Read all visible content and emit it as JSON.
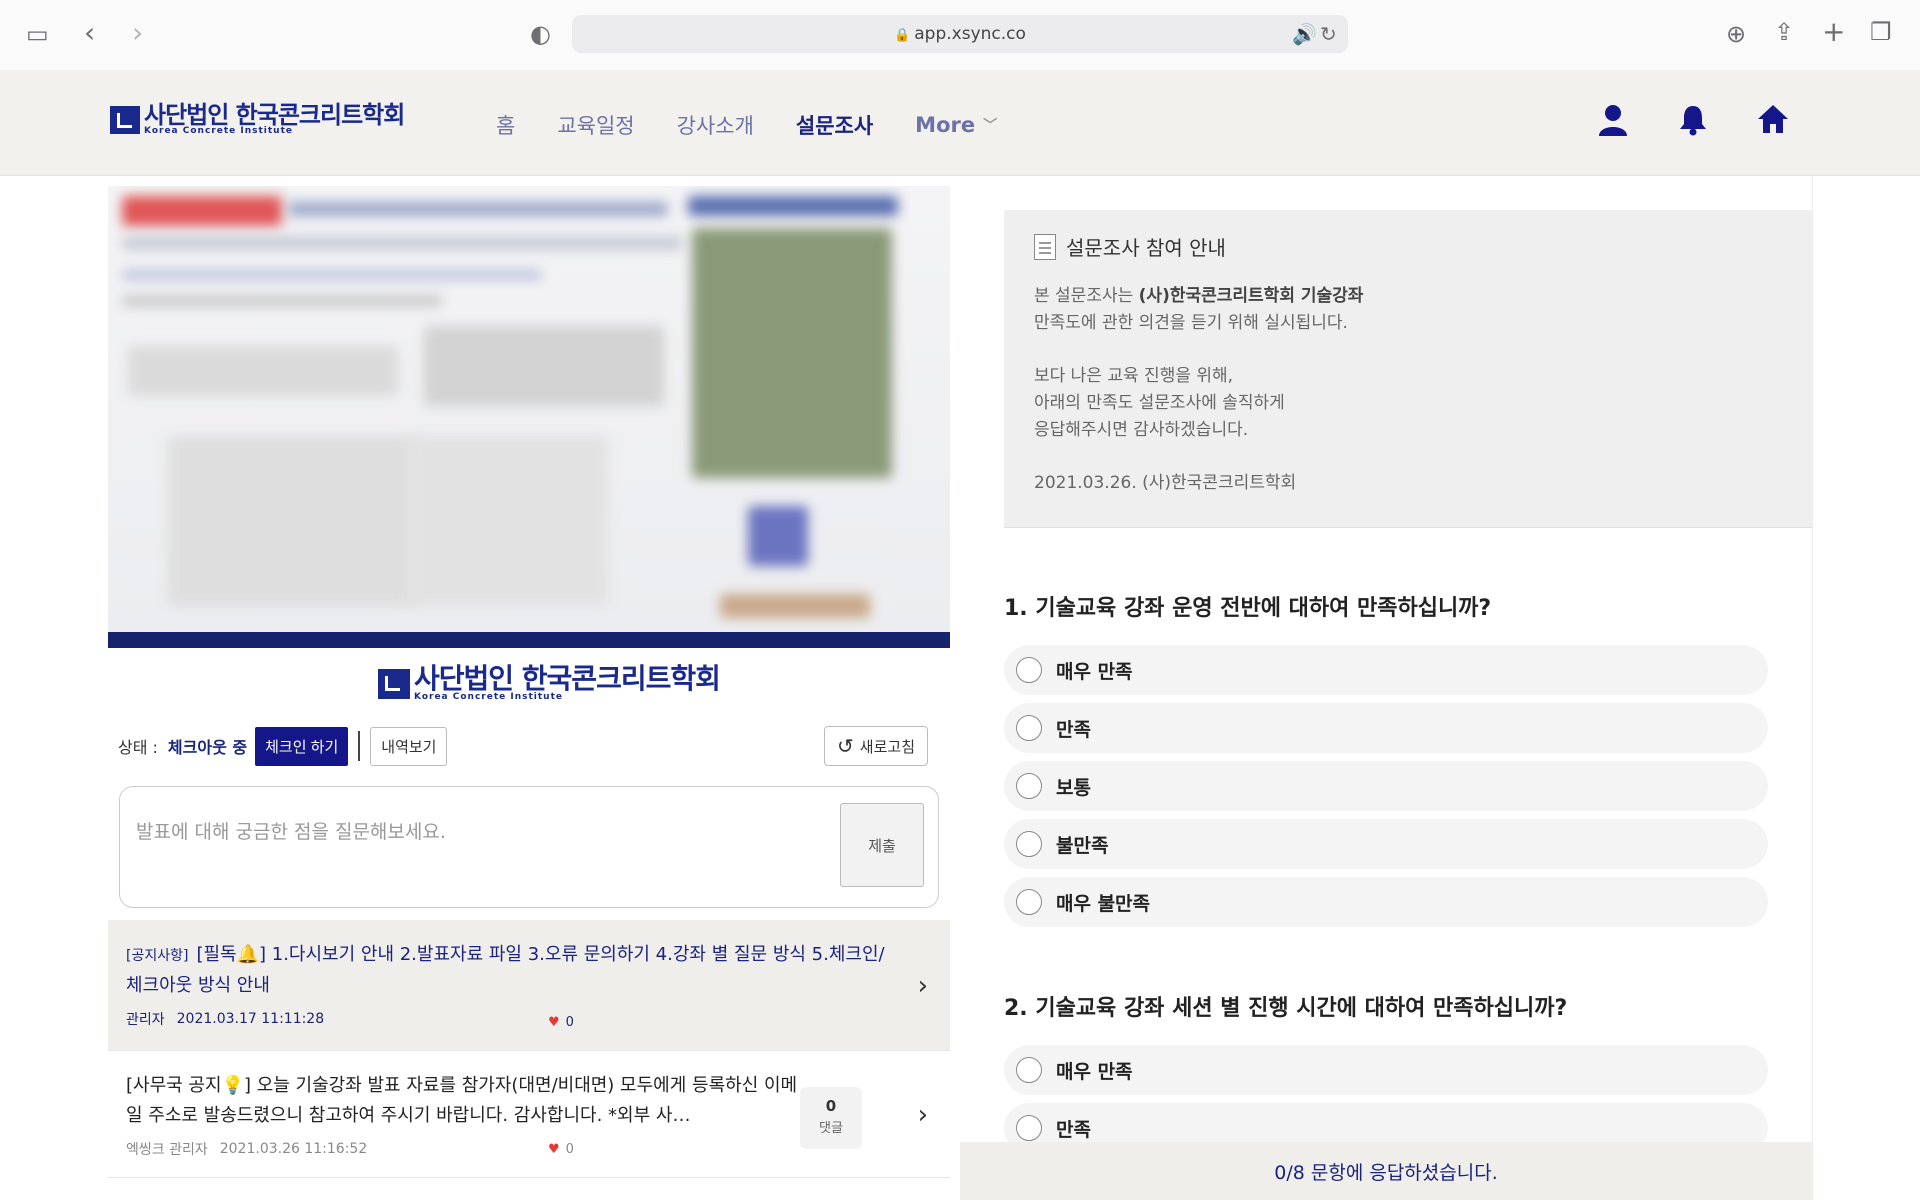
{
  "browser": {
    "url": "app.xsync.co"
  },
  "header": {
    "logo_main": "사단법인 한국콘크리트학회",
    "logo_sub": "Korea Concrete Institute",
    "nav": [
      {
        "label": "홈"
      },
      {
        "label": "교육일정"
      },
      {
        "label": "강사소개"
      },
      {
        "label": "설문조사"
      },
      {
        "label": "More"
      }
    ]
  },
  "left": {
    "status_label": "상태 :",
    "status_value": "체크아웃 중",
    "checkin_label": "체크인 하기",
    "history_label": "내역보기",
    "refresh_label": "새로고침",
    "question_placeholder": "발표에 대해 궁금한 점을 질문해보세요.",
    "submit_label": "제출",
    "notices": [
      {
        "tag": "[공지사항]",
        "title": "[필독🔔] 1.다시보기 안내 2.발표자료 파일 3.오류 문의하기 4.강좌 별 질문 방식 5.체크인/체크아웃 방식 안내",
        "author": "관리자",
        "date": "2021.03.17 11:11:28",
        "likes": "0"
      },
      {
        "title": "[사무국 공지💡] 오늘 기술강좌 발표 자료를 참가자(대면/비대면) 모두에게 등록하신 이메일 주소로 발송드렸으니 참고하여 주시기 바랍니다. 감사합니다. *외부 사…",
        "author": "엑씽크 관리자",
        "date": "2021.03.26 11:16:52",
        "likes": "0",
        "comments": "0",
        "comments_label": "댓글"
      }
    ]
  },
  "survey": {
    "info_title": "설문조사 참여 안내",
    "info_line1_prefix": "본 설문조사는 ",
    "info_line1_bold": "(사)한국콘크리트학회 기술강좌",
    "info_line2": "만족도에 관한 의견을 듣기 위해 실시됩니다.",
    "info_line3": "보다 나은 교육 진행을 위해,",
    "info_line4": "아래의 만족도 설문조사에 솔직하게",
    "info_line5": "응답해주시면 감사하겠습니다.",
    "info_sign": "2021.03.26. (사)한국콘크리트학회",
    "questions": [
      {
        "title": "1. 기술교육 강좌 운영 전반에 대하여 만족하십니까?",
        "options": [
          "매우 만족",
          "만족",
          "보통",
          "불만족",
          "매우 불만족"
        ]
      },
      {
        "title": "2. 기술교육 강좌 세션 별 진행 시간에 대하여 만족하십니까?",
        "options": [
          "매우 만족",
          "만족"
        ]
      }
    ],
    "progress": "0/8 문항에 응답하셨습니다."
  }
}
